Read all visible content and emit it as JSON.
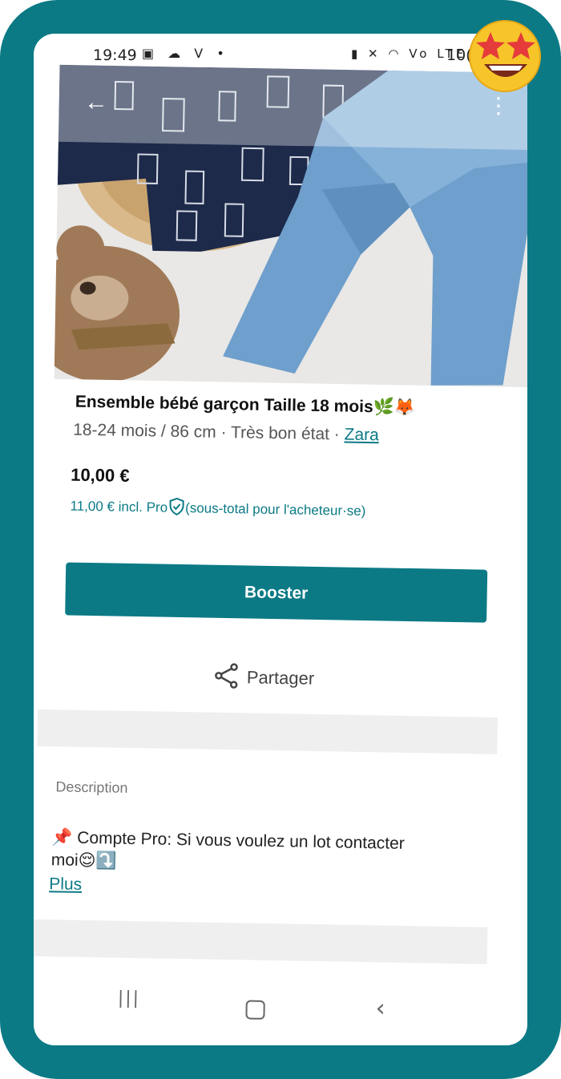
{
  "status_bar": {
    "time": "19:49",
    "left_icons": "▣ ☁ V •",
    "right_icons": "▮ ✕ ◠ Vo LTE ▐",
    "battery": "10("
  },
  "product": {
    "title": "Ensemble bébé garçon Taille 18 mois🌿🦊",
    "size_condition": "18-24 mois / 86 cm · Très bon état · ",
    "brand": "Zara",
    "price": "10,00 €",
    "price_incl_amount": "11,00 €",
    "price_incl_label": "incl. Pro",
    "price_incl_note": "(sous-total pour l'acheteur·se)"
  },
  "actions": {
    "booster_label": "Booster",
    "share_label": "Partager"
  },
  "description": {
    "heading": "Description",
    "text_line1": "📌 Compte Pro:  Si vous voulez un lot contacter",
    "text_line2": "moi😌⤵️",
    "more_link": "Plus"
  },
  "icons": {
    "back": "arrow-left-icon",
    "more": "more-vertical-icon",
    "share": "share-icon",
    "shield": "shield-check-icon",
    "sticker": "star-struck-emoji-icon"
  },
  "colors": {
    "accent": "#0b7a85",
    "frame": "#0b7a85",
    "band": "#efefef"
  }
}
